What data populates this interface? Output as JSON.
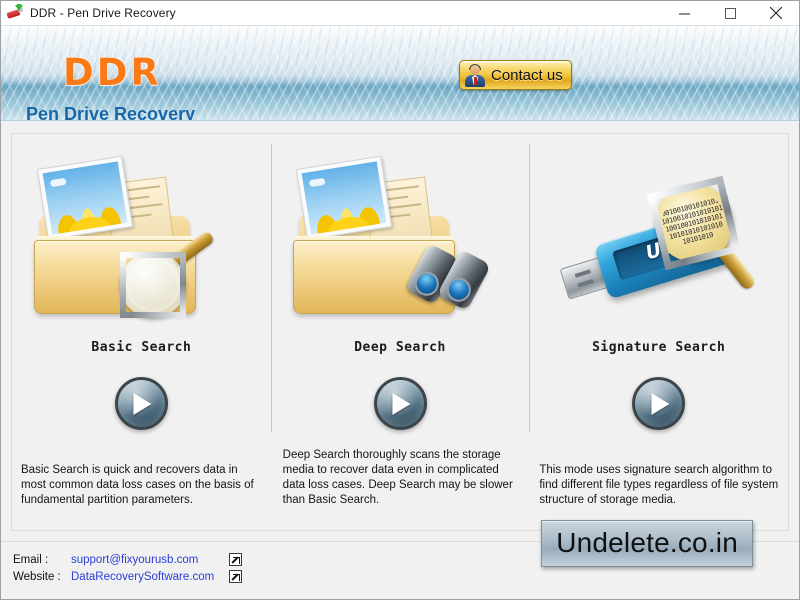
{
  "window": {
    "title": "DDR - Pen Drive Recovery",
    "app_icon": "usb-drive-download-icon",
    "controls": {
      "minimize": "minimize-icon",
      "maximize": "maximize-icon",
      "close": "close-icon"
    }
  },
  "banner": {
    "logo": "DDR",
    "subtitle": "Pen Drive Recovery",
    "contact_button": {
      "label": "Contact us",
      "icon": "user-avatar-icon"
    },
    "colors": {
      "logo_orange": "#fa7a18",
      "subtitle_blue": "#1667a8",
      "button_gold": "#efc33d"
    }
  },
  "modes": [
    {
      "id": "basic-search",
      "label": "Basic Search",
      "icon": "folder-with-photo-and-magnifier-icon",
      "description": "Basic Search is quick and recovers data in most common data loss cases on the basis of fundamental partition parameters.",
      "action": "play-button"
    },
    {
      "id": "deep-search",
      "label": "Deep Search",
      "icon": "folder-with-photo-and-binoculars-icon",
      "description": "Deep Search thoroughly scans the storage media to recover data even in complicated data loss cases. Deep Search may be slower than Basic Search.",
      "action": "play-button"
    },
    {
      "id": "signature-search",
      "label": "Signature Search",
      "icon": "usb-drive-with-binary-magnifier-icon",
      "description": "This mode uses signature search algorithm to find different file types regardless of file system structure of storage media.",
      "action": "play-button"
    }
  ],
  "usb_art": {
    "label": "USB",
    "binary_rows": [
      "001001001010101",
      "1010010101010101",
      "100100101010101",
      "10101010101010",
      "10101010"
    ]
  },
  "footer": {
    "email_label": "Email :",
    "email_value": "support@fixyourusb.com",
    "website_label": "Website :",
    "website_value": "DataRecoverySoftware.com",
    "link_color": "#2a3ed8",
    "external_icon": "external-link-icon"
  },
  "watermark": {
    "text": "Undelete.co.in"
  }
}
